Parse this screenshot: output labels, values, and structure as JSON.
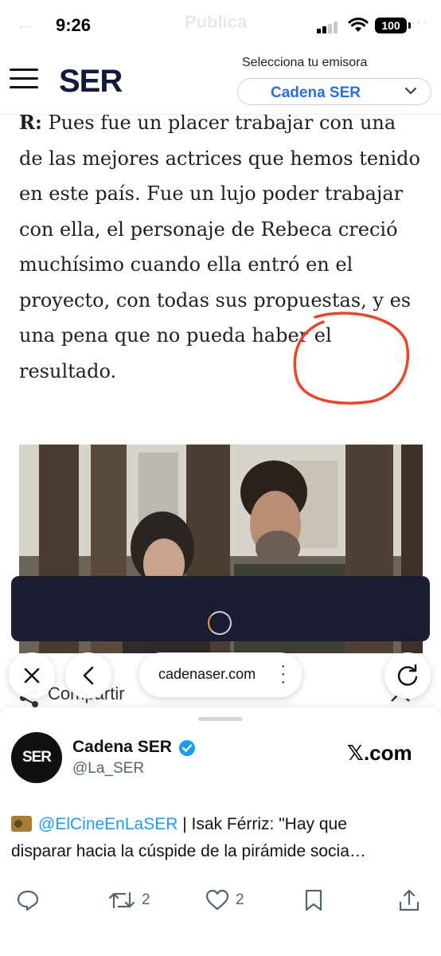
{
  "status": {
    "time": "9:26",
    "battery": "100",
    "ghost_title": "Publica"
  },
  "header": {
    "logo": "SER",
    "station_label": "Selecciona tu emisora",
    "station_value": "Cadena SER"
  },
  "article": {
    "lead": "R:",
    "paragraph": "Pues fue un placer trabajar con una de las mejores actrices que hemos tenido en este país. Fue un lujo poder trabajar con ella, el personaje de Rebeca creció muchísimo cuando ella entró en el proyecto, con todas sus propuestas, y es una pena que no pueda haber el resultado."
  },
  "share": {
    "label": "Compartir"
  },
  "browser": {
    "url": "cadenaser.com"
  },
  "tweet_card": {
    "avatar_text": "SER",
    "display_name": "Cadena SER",
    "handle": "@La_SER",
    "source": "𝕏.com",
    "mention": "@ElCineEnLaSER",
    "text_line1_rest": " | Isak Férriz: \"Hay que",
    "text_line2": "disparar hacia la cúspide de la pirámide socia…",
    "retweets": "2",
    "likes": "2"
  },
  "colors": {
    "brand_navy": "#0f1a3d",
    "accent_blue": "#2a6fd6",
    "link_blue": "#1d9bf0",
    "annotation_red": "#e8472a"
  },
  "icons": [
    "hamburger-icon",
    "chevron-down-icon",
    "close-icon",
    "back-icon",
    "more-icon",
    "reload-icon",
    "share-icon",
    "reply-icon",
    "retweet-icon",
    "like-icon",
    "bookmark-icon",
    "upload-icon",
    "verified-icon",
    "radio-emoji-icon"
  ]
}
